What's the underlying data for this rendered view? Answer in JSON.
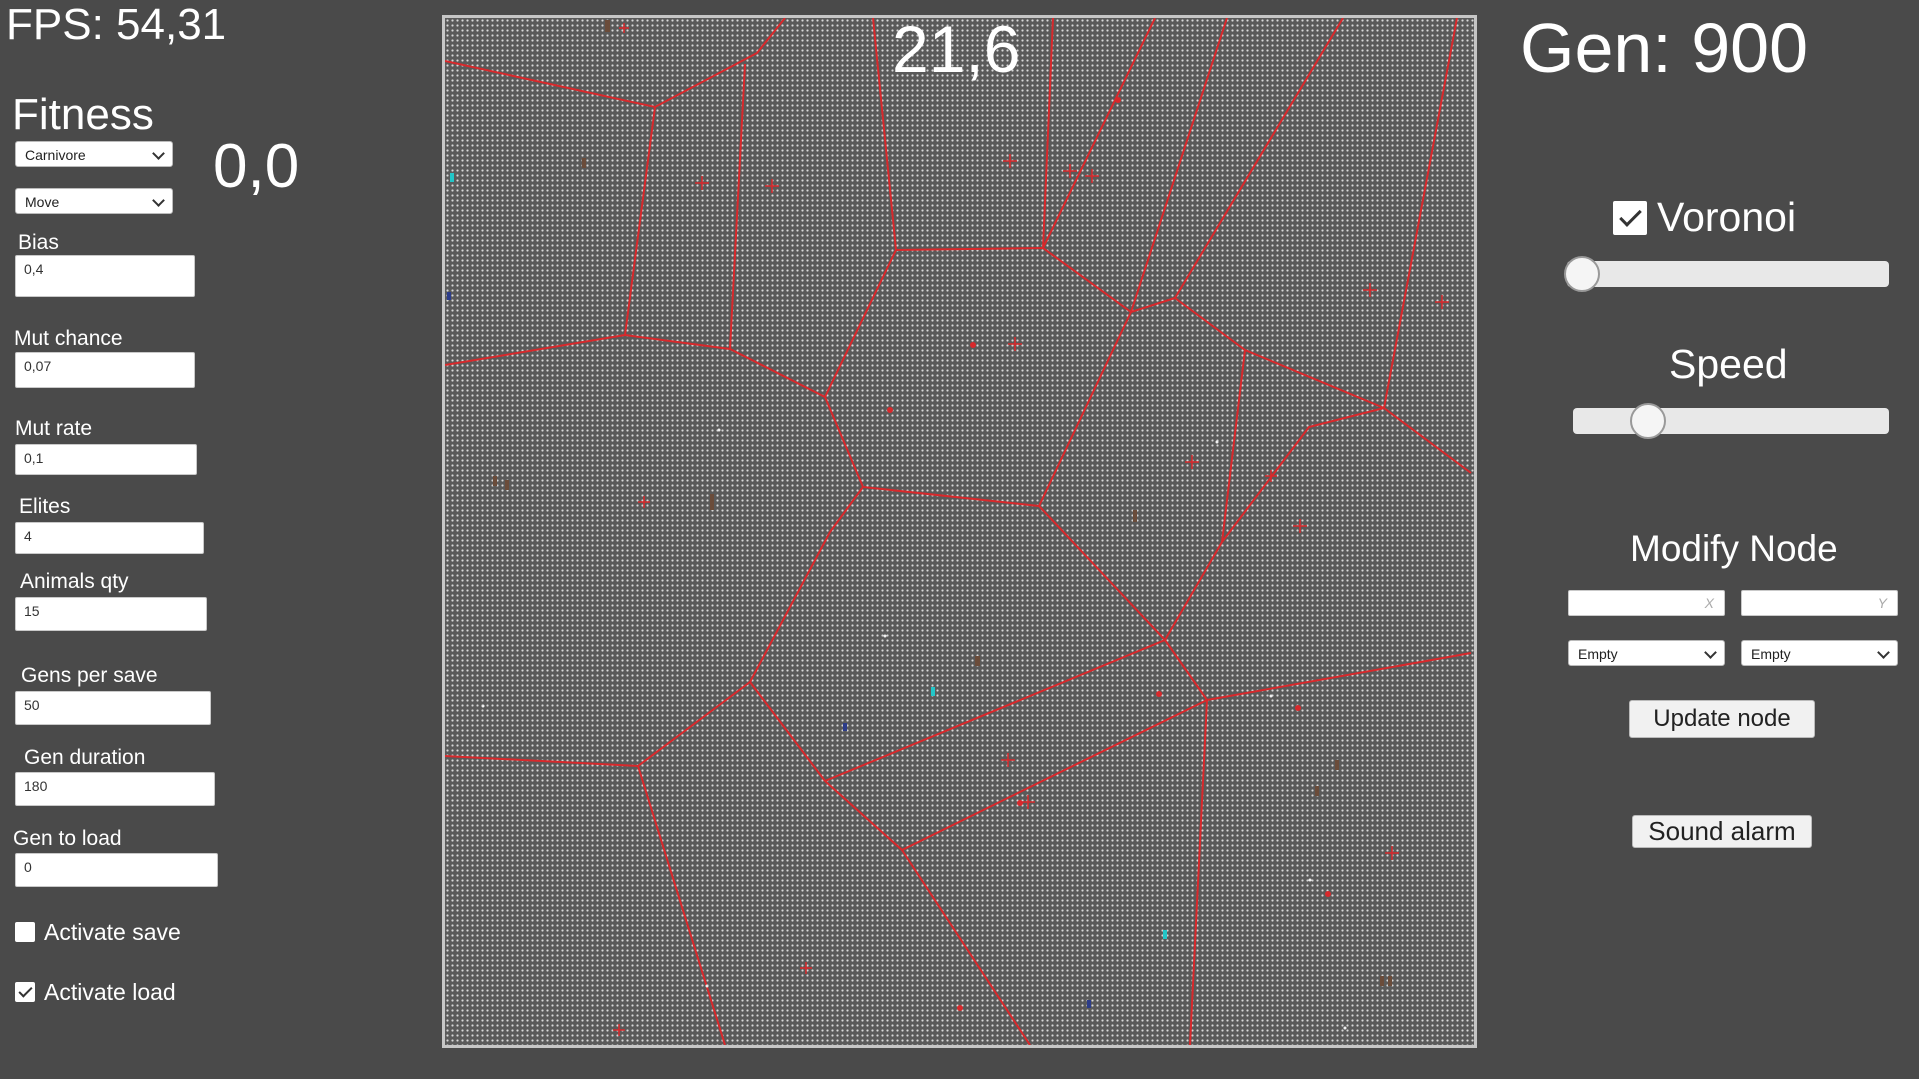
{
  "fps_text": "FPS: 54,31",
  "fitness": {
    "title": "Fitness",
    "value": "0,0",
    "animal_type": "Carnivore",
    "action": "Move"
  },
  "params": {
    "bias": {
      "label": "Bias",
      "value": "0,4"
    },
    "mut_chance": {
      "label": "Mut chance",
      "value": "0,07"
    },
    "mut_rate": {
      "label": "Mut rate",
      "value": "0,1"
    },
    "elites": {
      "label": "Elites",
      "value": "4"
    },
    "animals_qty": {
      "label": "Animals qty",
      "value": "15"
    },
    "gens_per_save": {
      "label": "Gens per save",
      "value": "50"
    },
    "gen_duration": {
      "label": "Gen duration",
      "value": "180"
    },
    "gen_to_load": {
      "label": "Gen to load",
      "value": "0"
    }
  },
  "toggles": {
    "activate_save": {
      "label": "Activate save",
      "checked": false
    },
    "activate_load": {
      "label": "Activate load",
      "checked": true
    }
  },
  "simulation": {
    "timer": "21,6",
    "generation": "Gen: 900"
  },
  "controls": {
    "voronoi": {
      "label": "Voronoi",
      "checked": true,
      "slider_level": 0.0
    },
    "speed": {
      "label": "Speed",
      "slider_level": 0.24
    },
    "modify_node": {
      "title": "Modify Node",
      "x_placeholder": "X",
      "y_placeholder": "Y",
      "select_1": "Empty",
      "select_2": "Empty",
      "update_label": "Update node"
    },
    "sound_alarm_label": "Sound alarm"
  },
  "colors": {
    "background": "#4a4a4a",
    "voronoi_lines": "#d9282b",
    "grid": "#d8d8d8"
  }
}
